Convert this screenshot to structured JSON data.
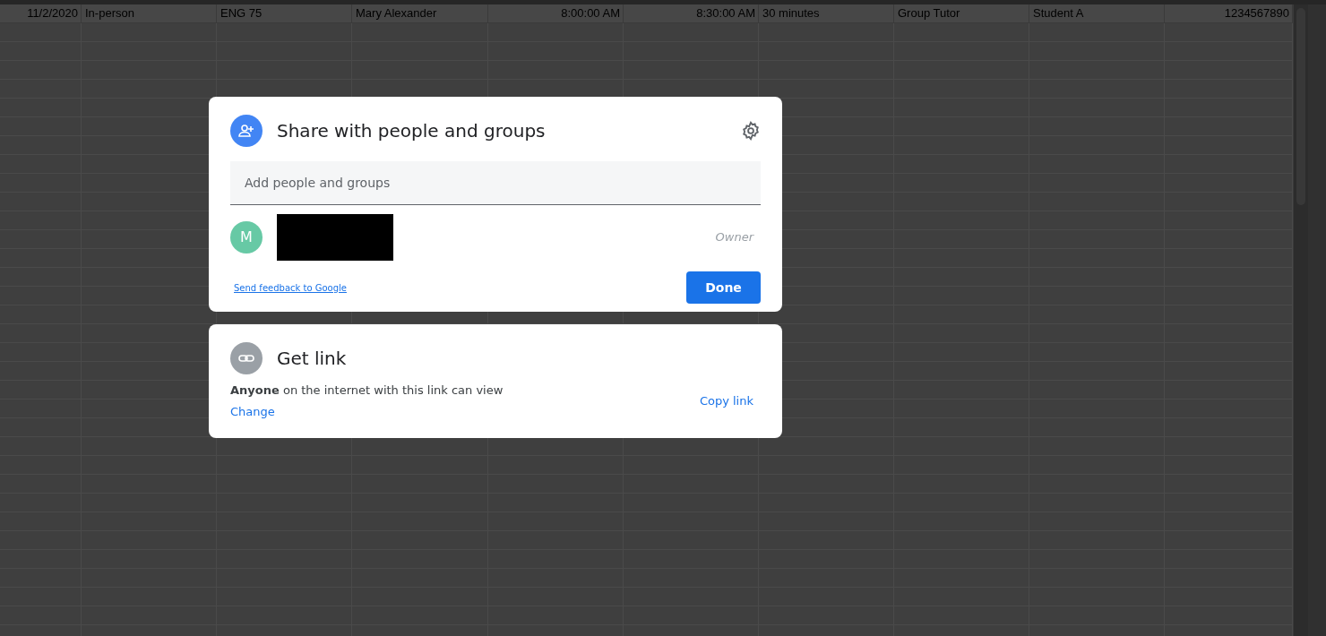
{
  "sheet": {
    "row": [
      "11/2/2020",
      "In-person",
      "ENG 75",
      "Mary Alexander",
      "8:00:00 AM",
      "8:30:00 AM",
      "30 minutes",
      "Group Tutor",
      "Student A",
      "1234567890"
    ]
  },
  "share": {
    "title": "Share with people and groups",
    "placeholder": "Add people and groups",
    "person": {
      "initial": "M",
      "color": "#67c9a5",
      "role": "Owner",
      "redacted": true
    },
    "feedback": "Send feedback to Google",
    "done": "Done"
  },
  "link": {
    "title": "Get link",
    "access": "**Anyone** on the internet with this link can view",
    "change": "Change",
    "copy": "Copy link"
  }
}
